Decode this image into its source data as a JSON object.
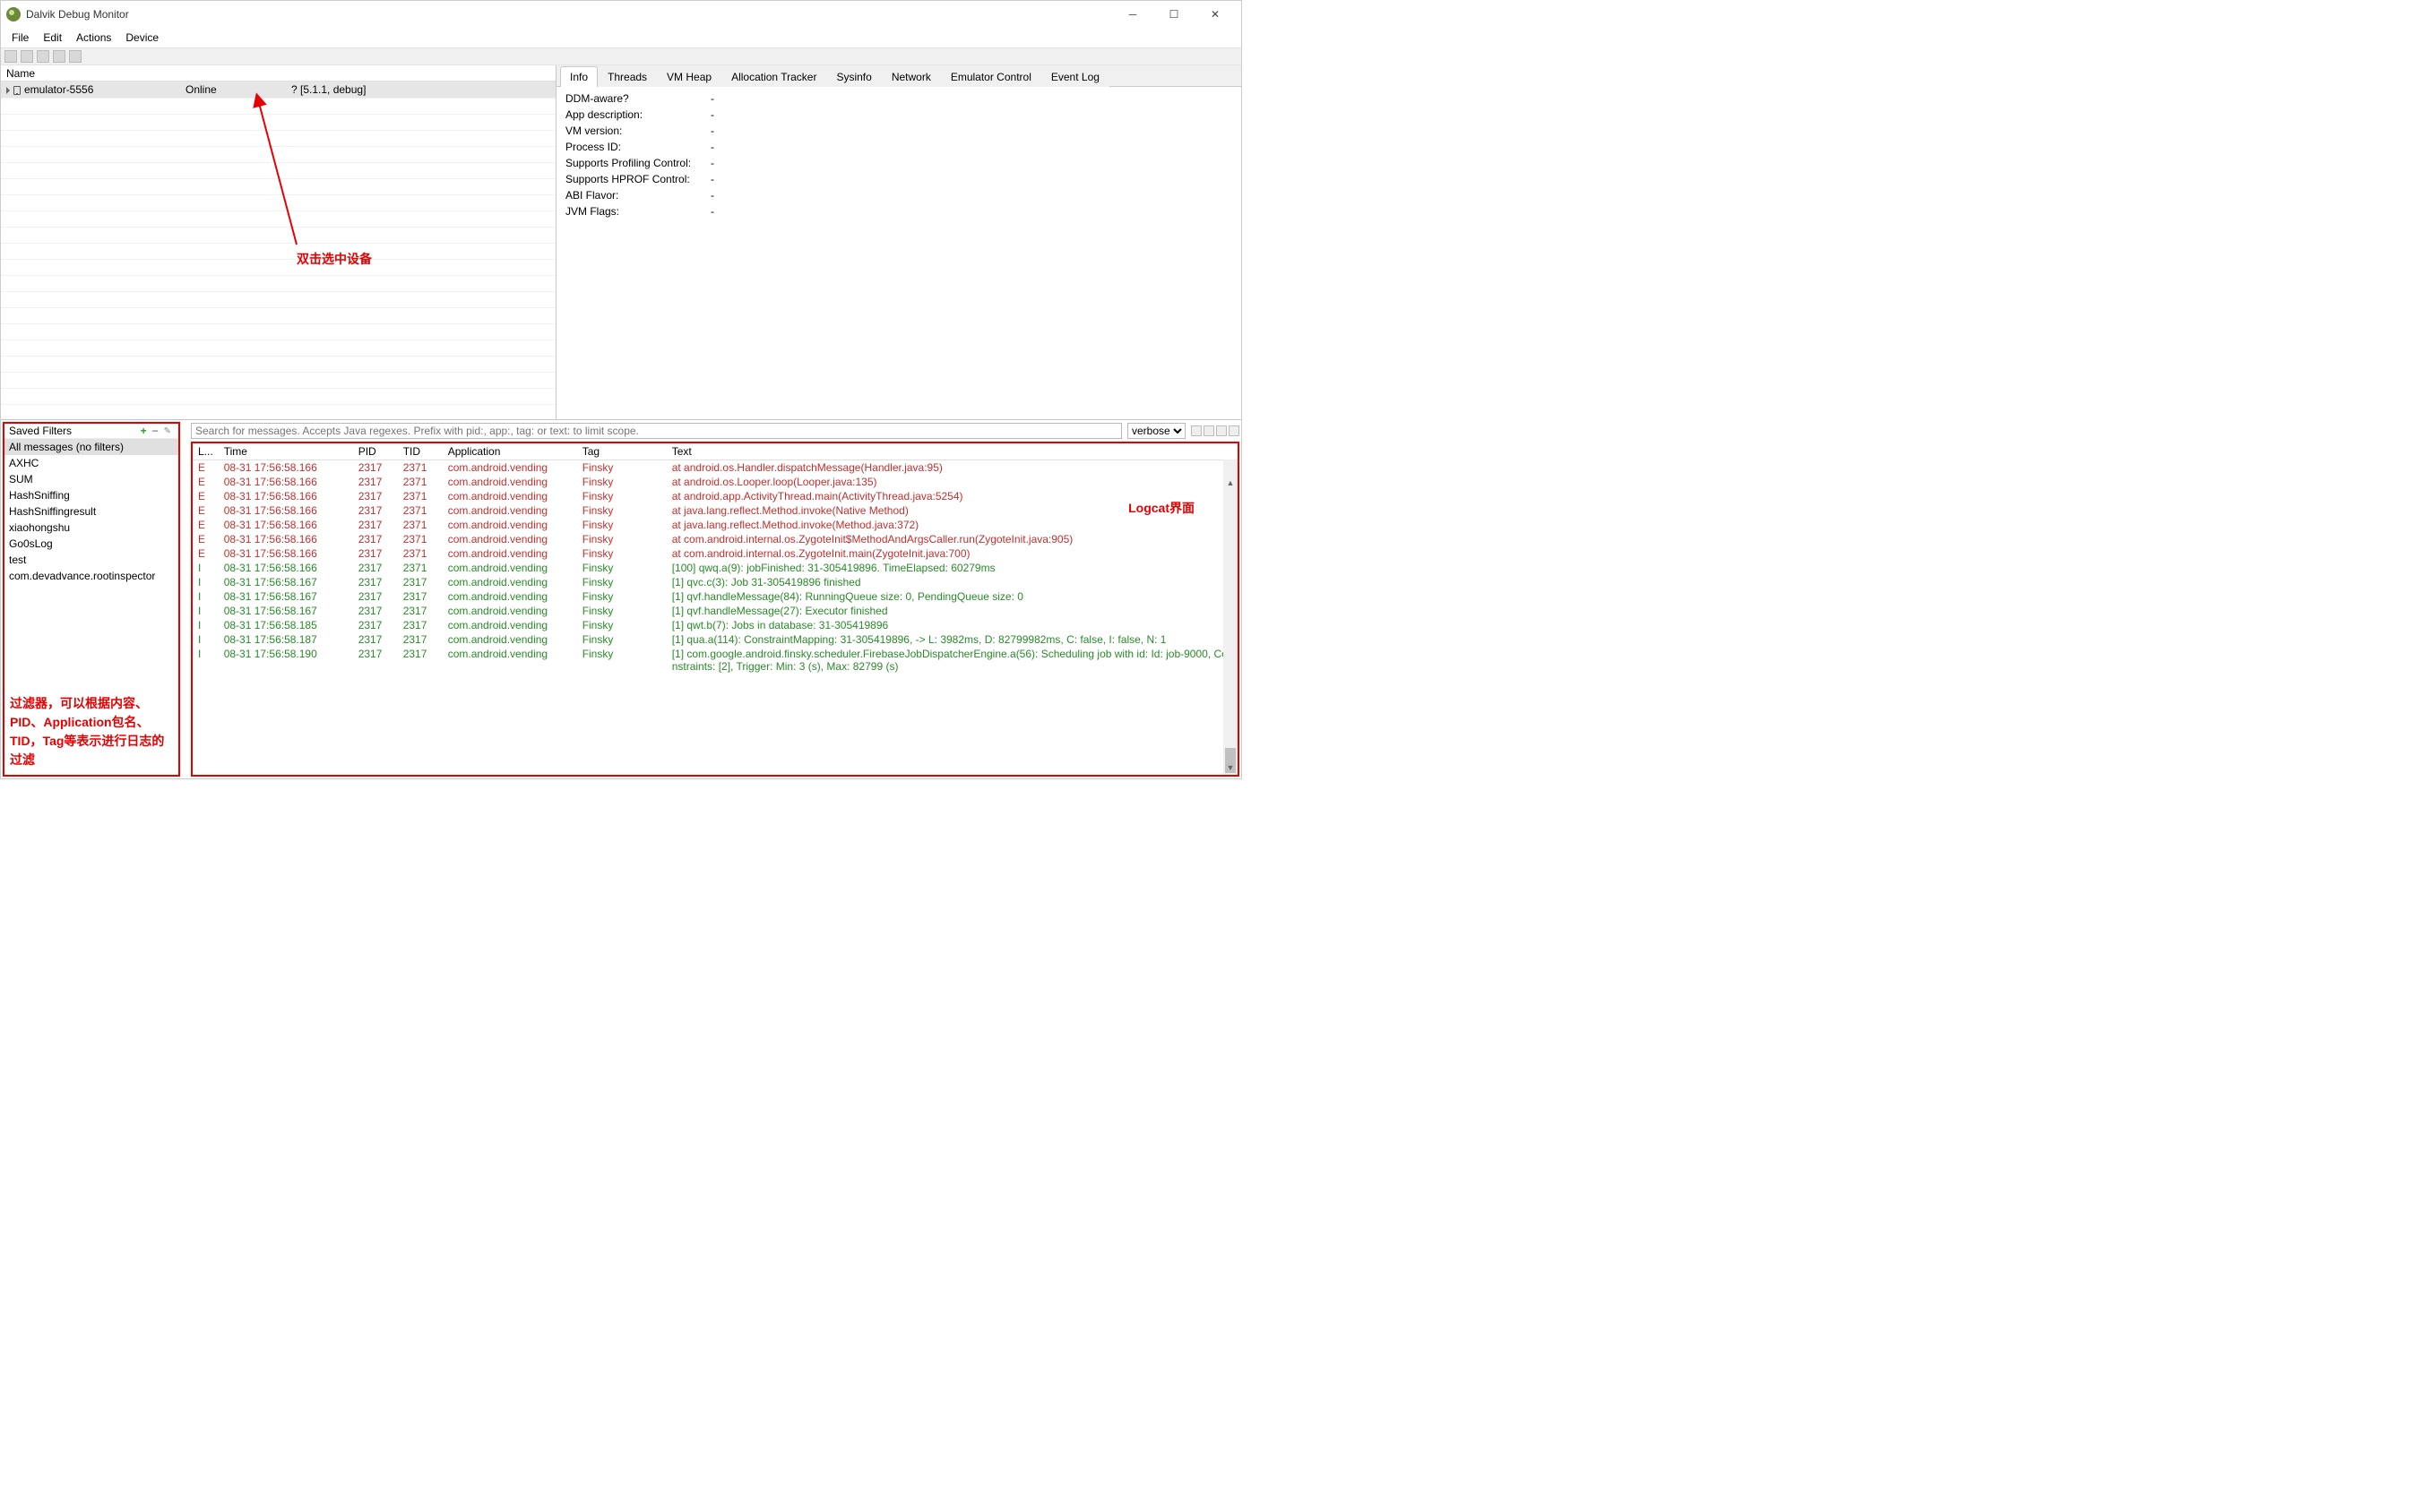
{
  "window": {
    "title": "Dalvik Debug Monitor"
  },
  "menu": [
    "File",
    "Edit",
    "Actions",
    "Device"
  ],
  "device_panel": {
    "header": "Name",
    "columns": [
      "",
      "",
      ""
    ],
    "rows": [
      {
        "name": "emulator-5556",
        "status": "Online",
        "detail": "? [5.1.1, debug]",
        "selected": true
      }
    ],
    "annotation": "双击选中设备"
  },
  "tabs": [
    "Info",
    "Threads",
    "VM Heap",
    "Allocation Tracker",
    "Sysinfo",
    "Network",
    "Emulator Control",
    "Event Log"
  ],
  "active_tab": "Info",
  "info_rows": [
    {
      "k": "DDM-aware?",
      "v": "-"
    },
    {
      "k": "App description:",
      "v": "-"
    },
    {
      "k": "VM version:",
      "v": "-"
    },
    {
      "k": "Process ID:",
      "v": "-"
    },
    {
      "k": "Supports Profiling Control:",
      "v": "-"
    },
    {
      "k": "Supports HPROF Control:",
      "v": "-"
    },
    {
      "k": "ABI Flavor:",
      "v": "-"
    },
    {
      "k": "JVM Flags:",
      "v": "-"
    }
  ],
  "filters": {
    "header": "Saved Filters",
    "items": [
      "All messages (no filters)",
      "AXHC",
      "SUM",
      "HashSniffing",
      "HashSniffingresult",
      "xiaohongshu",
      "Go0sLog",
      "test",
      "com.devadvance.rootinspector"
    ],
    "selected": 0,
    "annotation": "过滤器，可以根据内容、PID、Application包名、TID，Tag等表示进行日志的过滤"
  },
  "logcat": {
    "search_placeholder": "Search for messages. Accepts Java regexes. Prefix with pid:, app:, tag: or text: to limit scope.",
    "level": "verbose",
    "headers": [
      "L...",
      "Time",
      "PID",
      "TID",
      "Application",
      "Tag",
      "Text"
    ],
    "annotation": "Logcat界面",
    "rows": [
      {
        "lv": "E",
        "t": "08-31 17:56:58.166",
        "pid": "2317",
        "tid": "2371",
        "app": "com.android.vending",
        "tag": "Finsky",
        "txt": "at android.os.Handler.dispatchMessage(Handler.java:95)"
      },
      {
        "lv": "E",
        "t": "08-31 17:56:58.166",
        "pid": "2317",
        "tid": "2371",
        "app": "com.android.vending",
        "tag": "Finsky",
        "txt": "at android.os.Looper.loop(Looper.java:135)"
      },
      {
        "lv": "E",
        "t": "08-31 17:56:58.166",
        "pid": "2317",
        "tid": "2371",
        "app": "com.android.vending",
        "tag": "Finsky",
        "txt": "at android.app.ActivityThread.main(ActivityThread.java:5254)"
      },
      {
        "lv": "E",
        "t": "08-31 17:56:58.166",
        "pid": "2317",
        "tid": "2371",
        "app": "com.android.vending",
        "tag": "Finsky",
        "txt": "at java.lang.reflect.Method.invoke(Native Method)"
      },
      {
        "lv": "E",
        "t": "08-31 17:56:58.166",
        "pid": "2317",
        "tid": "2371",
        "app": "com.android.vending",
        "tag": "Finsky",
        "txt": "at java.lang.reflect.Method.invoke(Method.java:372)"
      },
      {
        "lv": "E",
        "t": "08-31 17:56:58.166",
        "pid": "2317",
        "tid": "2371",
        "app": "com.android.vending",
        "tag": "Finsky",
        "txt": "at com.android.internal.os.ZygoteInit$MethodAndArgsCaller.run(ZygoteInit.java:905)"
      },
      {
        "lv": "E",
        "t": "08-31 17:56:58.166",
        "pid": "2317",
        "tid": "2371",
        "app": "com.android.vending",
        "tag": "Finsky",
        "txt": "at com.android.internal.os.ZygoteInit.main(ZygoteInit.java:700)"
      },
      {
        "lv": "I",
        "t": "08-31 17:56:58.166",
        "pid": "2317",
        "tid": "2371",
        "app": "com.android.vending",
        "tag": "Finsky",
        "txt": "[100] qwq.a(9): jobFinished: 31-305419896. TimeElapsed: 60279ms"
      },
      {
        "lv": "I",
        "t": "08-31 17:56:58.167",
        "pid": "2317",
        "tid": "2317",
        "app": "com.android.vending",
        "tag": "Finsky",
        "txt": "[1] qvc.c(3): Job 31-305419896 finished"
      },
      {
        "lv": "I",
        "t": "08-31 17:56:58.167",
        "pid": "2317",
        "tid": "2317",
        "app": "com.android.vending",
        "tag": "Finsky",
        "txt": "[1] qvf.handleMessage(84): RunningQueue size: 0, PendingQueue size: 0"
      },
      {
        "lv": "I",
        "t": "08-31 17:56:58.167",
        "pid": "2317",
        "tid": "2317",
        "app": "com.android.vending",
        "tag": "Finsky",
        "txt": "[1] qvf.handleMessage(27): Executor finished"
      },
      {
        "lv": "I",
        "t": "08-31 17:56:58.185",
        "pid": "2317",
        "tid": "2317",
        "app": "com.android.vending",
        "tag": "Finsky",
        "txt": "[1] qwt.b(7): Jobs in database: 31-305419896"
      },
      {
        "lv": "I",
        "t": "08-31 17:56:58.187",
        "pid": "2317",
        "tid": "2317",
        "app": "com.android.vending",
        "tag": "Finsky",
        "txt": "[1] qua.a(114): ConstraintMapping: 31-305419896,  -> L: 3982ms, D: 82799982ms, C: false, I: false, N: 1"
      },
      {
        "lv": "I",
        "t": "08-31 17:56:58.190",
        "pid": "2317",
        "tid": "2317",
        "app": "com.android.vending",
        "tag": "Finsky",
        "txt": "[1] com.google.android.finsky.scheduler.FirebaseJobDispatcherEngine.a(56): Scheduling job with id: Id: job-9000, Constraints: [2], Trigger: Min: 3 (s), Max: 82799 (s)"
      }
    ]
  }
}
